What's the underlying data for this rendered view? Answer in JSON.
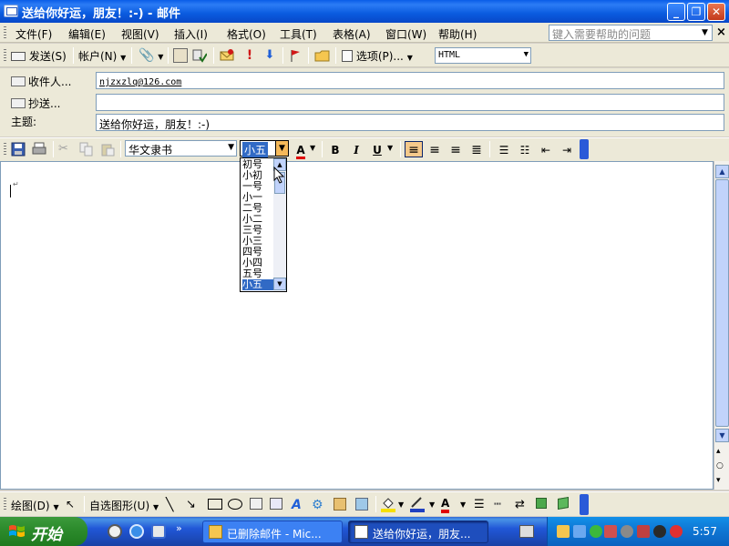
{
  "window": {
    "title": "送给你好运，朋友！:-) - 邮件",
    "buttons": {
      "minimize": "_",
      "maximize": "❐",
      "close": "✕"
    }
  },
  "menubar": {
    "items": [
      "文件(F)",
      "编辑(E)",
      "视图(V)",
      "插入(I)",
      "格式(O)",
      "工具(T)",
      "表格(A)",
      "窗口(W)",
      "帮助(H)"
    ],
    "help_placeholder": "键入需要帮助的问题"
  },
  "toolbar": {
    "send": "发送(S)",
    "account": "帐户(N)",
    "options": "选项(P)...",
    "format": "HTML"
  },
  "fields": {
    "to_label": "收件人...",
    "to_value": "njzxzlq@126.com",
    "cc_label": "抄送...",
    "cc_value": "",
    "subject_label": "主题:",
    "subject_value": "送给你好运，朋友！:-)"
  },
  "formatting": {
    "font": "华文隶书",
    "size": "小五",
    "bold": "B",
    "italic": "I",
    "underline": "U",
    "font_color": "A"
  },
  "size_list": {
    "options": [
      "初号",
      "小初",
      "一号",
      "小一",
      "二号",
      "小二",
      "三号",
      "小三",
      "四号",
      "小四",
      "五号",
      "小五"
    ],
    "selected": "小五"
  },
  "drawing_toolbar": {
    "draw": "绘图(D)",
    "autoshapes": "自选图形(U)"
  },
  "taskbar": {
    "start": "开始",
    "tasks": [
      "已删除邮件 - Mic...",
      "送给你好运，朋友..."
    ],
    "clock": "5:57"
  },
  "colors": {
    "titlebar": "#0a5de8",
    "selection": "#316ac5",
    "font_color_bar": "#e00000",
    "taskbar": "#2157d7",
    "start": "#2d8c2d"
  }
}
